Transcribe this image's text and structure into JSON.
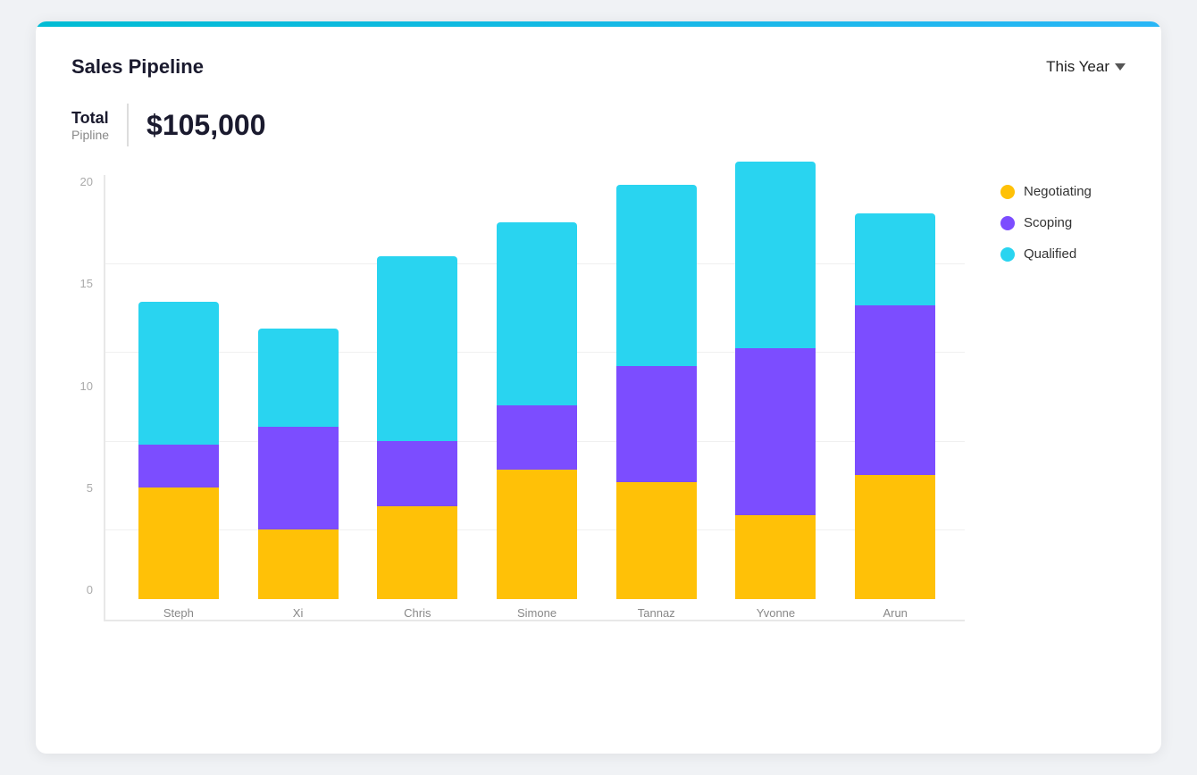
{
  "header": {
    "title": "Sales Pipeline",
    "period_label": "This Year"
  },
  "summary": {
    "total_label": "Total",
    "pipeline_label": "Pipline",
    "value": "$105,000"
  },
  "chart": {
    "y_axis": [
      "0",
      "5",
      "10",
      "15",
      "20"
    ],
    "max_value": 25,
    "colors": {
      "negotiating": "#FFC107",
      "scoping": "#7C4DFF",
      "qualified": "#29D4F0"
    },
    "bars": [
      {
        "name": "Steph",
        "negotiating": 6.3,
        "scoping": 2.4,
        "qualified": 8.0
      },
      {
        "name": "Xi",
        "negotiating": 3.9,
        "scoping": 5.8,
        "qualified": 5.5
      },
      {
        "name": "Chris",
        "negotiating": 5.2,
        "scoping": 3.7,
        "qualified": 10.4
      },
      {
        "name": "Simone",
        "negotiating": 7.3,
        "scoping": 3.6,
        "qualified": 10.3
      },
      {
        "name": "Tannaz",
        "negotiating": 6.6,
        "scoping": 6.5,
        "qualified": 10.2
      },
      {
        "name": "Yvonne",
        "negotiating": 4.7,
        "scoping": 9.4,
        "qualified": 10.5
      },
      {
        "name": "Arun",
        "negotiating": 7.0,
        "scoping": 9.5,
        "qualified": 5.2
      }
    ],
    "legend": [
      {
        "key": "negotiating",
        "label": "Negotiating",
        "color": "#FFC107"
      },
      {
        "key": "scoping",
        "label": "Scoping",
        "color": "#7C4DFF"
      },
      {
        "key": "qualified",
        "label": "Qualified",
        "color": "#29D4F0"
      }
    ]
  }
}
